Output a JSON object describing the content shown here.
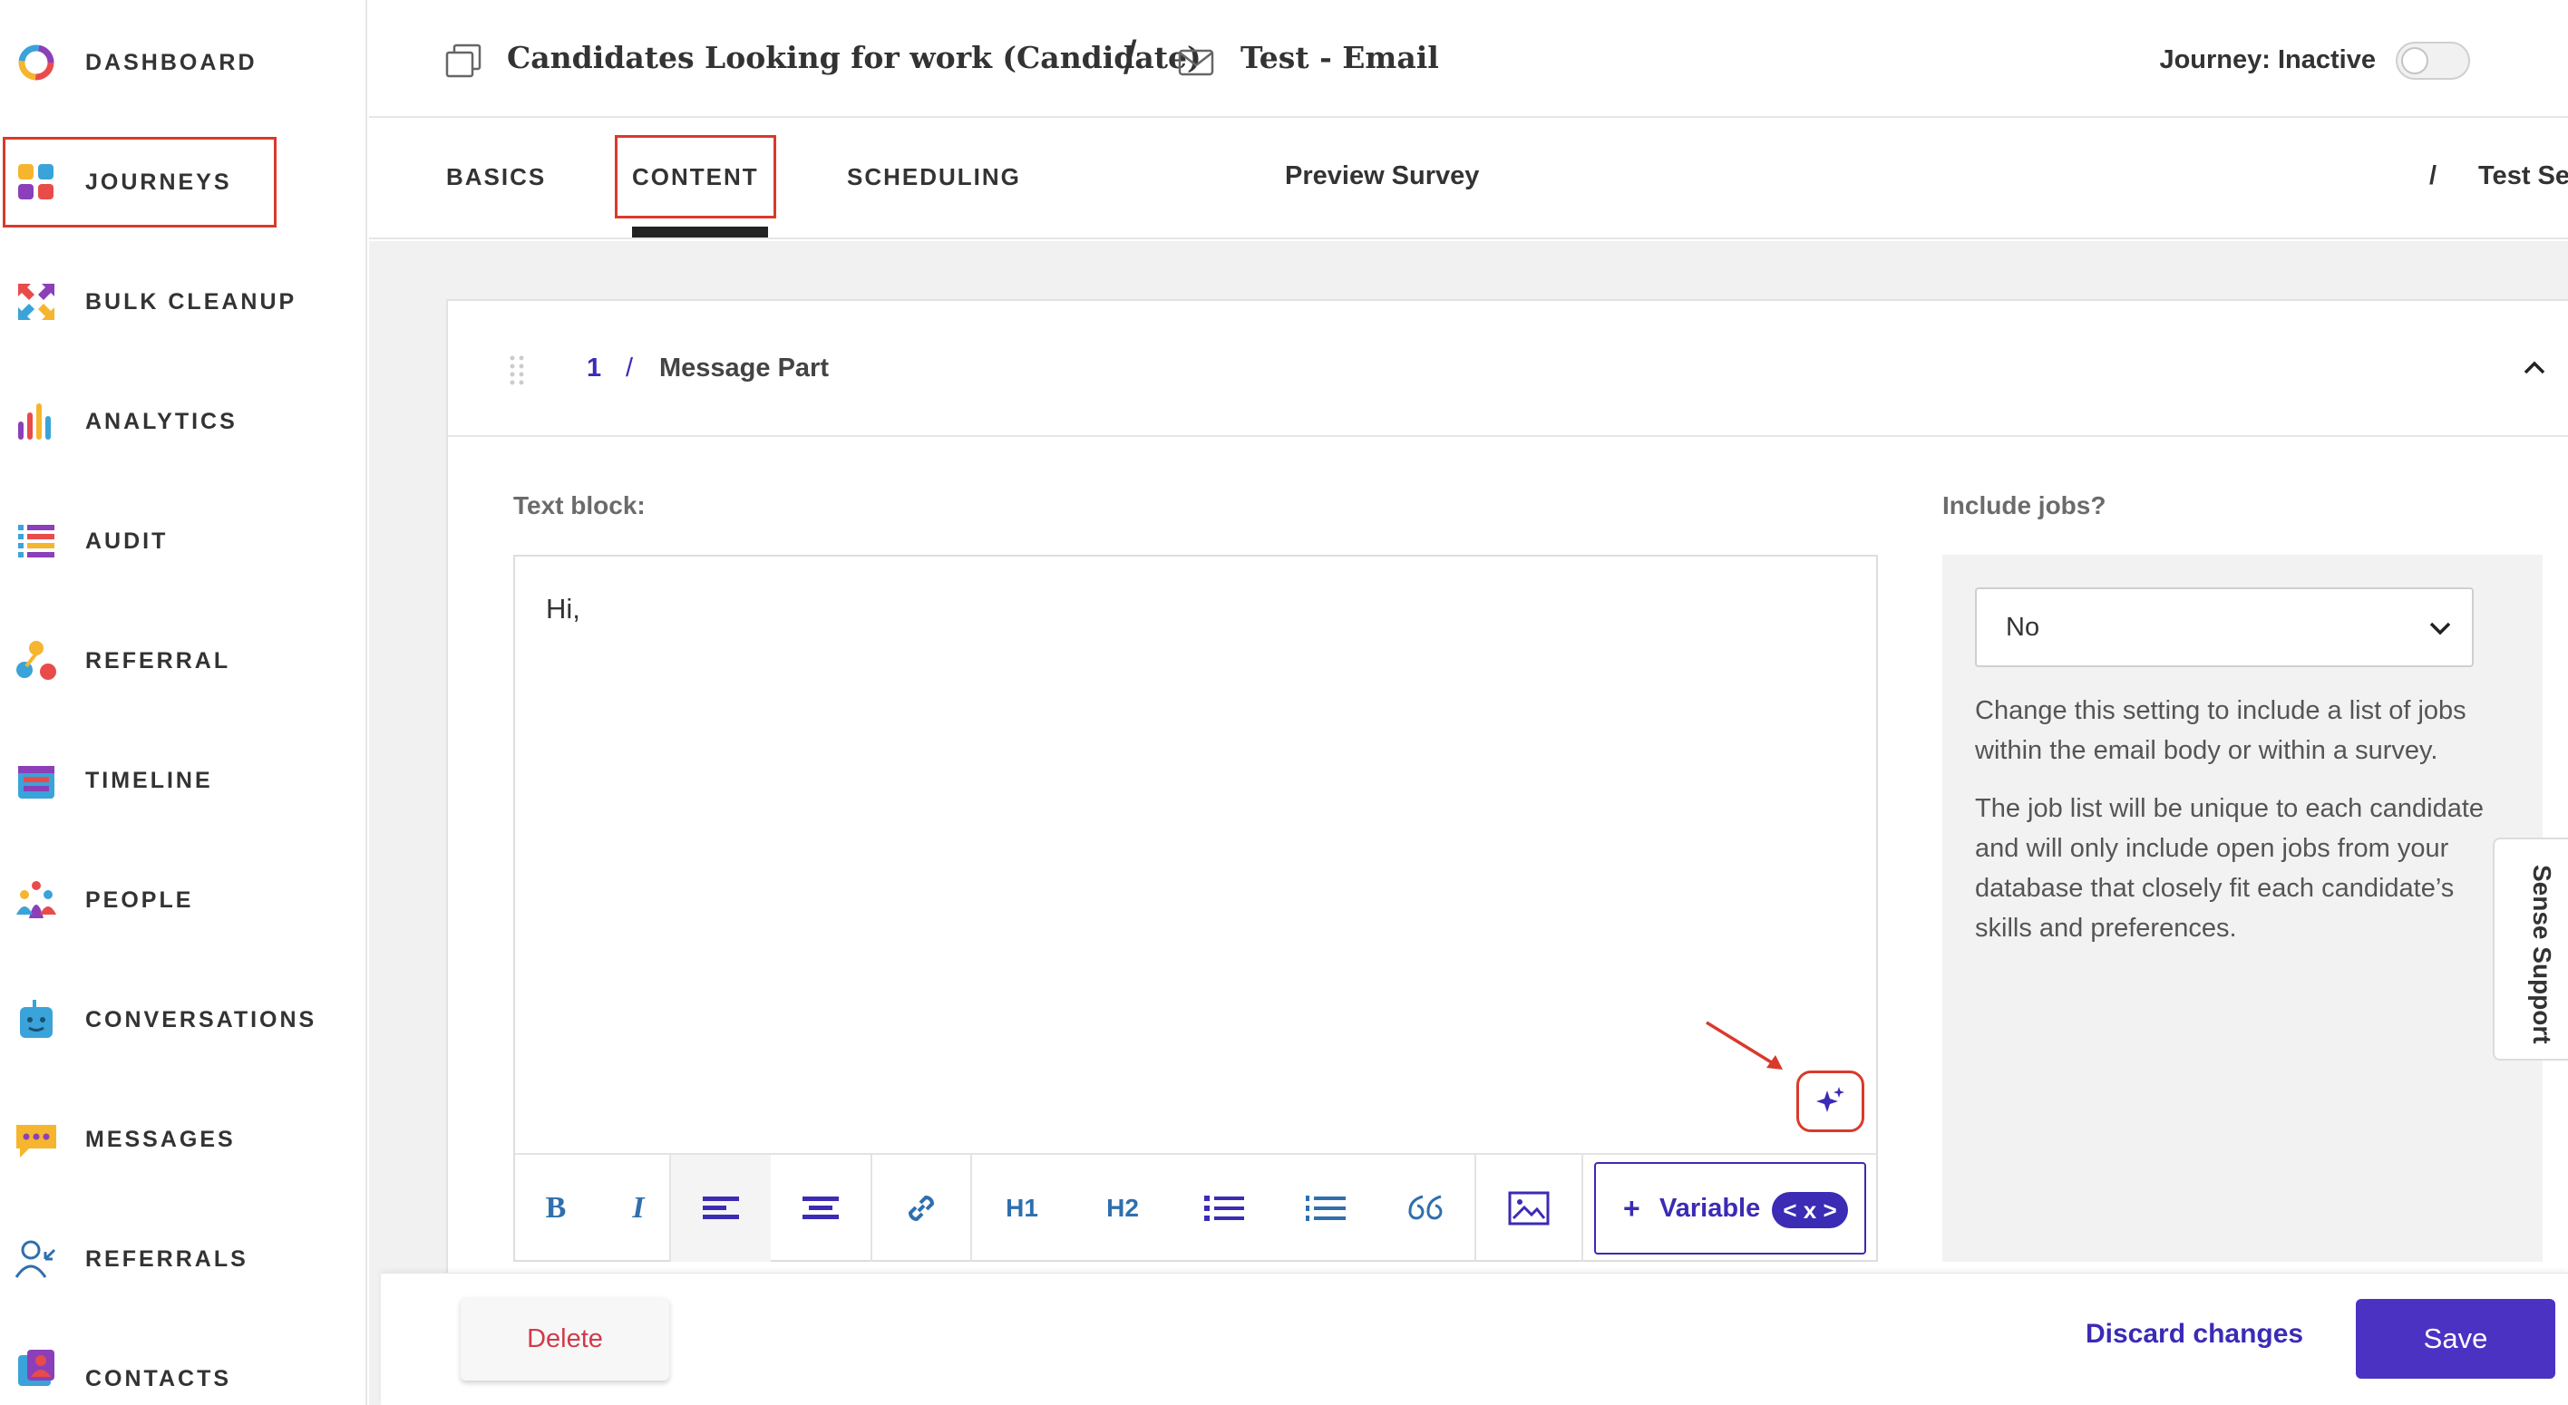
{
  "sidebar": {
    "items": [
      {
        "label": "DASHBOARD",
        "icon": "dashboard-ring-icon"
      },
      {
        "label": "JOURNEYS",
        "icon": "journeys-grid-icon"
      },
      {
        "label": "BULK CLEANUP",
        "icon": "bulk-cleanup-arrows-icon"
      },
      {
        "label": "ANALYTICS",
        "icon": "analytics-bars-icon"
      },
      {
        "label": "AUDIT",
        "icon": "audit-list-icon"
      },
      {
        "label": "REFERRAL",
        "icon": "referral-dots-icon"
      },
      {
        "label": "TIMELINE",
        "icon": "timeline-calendar-icon"
      },
      {
        "label": "PEOPLE",
        "icon": "people-group-icon"
      },
      {
        "label": "CONVERSATIONS",
        "icon": "conversations-robot-icon"
      },
      {
        "label": "MESSAGES",
        "icon": "messages-bubble-icon"
      },
      {
        "label": "REFERRALS",
        "icon": "referrals-person-icon"
      },
      {
        "label": "CONTACTS",
        "icon": "contacts-icon"
      }
    ],
    "active": "JOURNEYS"
  },
  "header": {
    "journey_title": "Candidates Looking for work (Candidate)",
    "separator": "/",
    "step_title": "Test - Email",
    "journey_status": "Journey: Inactive",
    "toggle_on": false
  },
  "tabs": {
    "items": [
      "BASICS",
      "CONTENT",
      "SCHEDULING"
    ],
    "active": "CONTENT",
    "preview_survey": "Preview Survey",
    "separator": "/",
    "test_send": "Test Se"
  },
  "message_part": {
    "number": "1",
    "separator": "/",
    "title": "Message Part"
  },
  "editor": {
    "label": "Text block:",
    "content": "Hi,",
    "toolbar": {
      "bold": "B",
      "italic": "I",
      "h1": "H1",
      "h2": "H2",
      "variable_plus": "+",
      "variable_label": "Variable",
      "variable_chip": "< x >"
    }
  },
  "jobs": {
    "label": "Include jobs?",
    "selected": "No",
    "help_1": "Change this setting to include a list of jobs within the email body or within a survey.",
    "help_2": "The job list will be unique to each candidate and will only include open jobs from your database that closely fit each candidate’s skills and preferences."
  },
  "support": {
    "label": "Sense Support"
  },
  "footer": {
    "delete": "Delete",
    "discard": "Discard changes",
    "save": "Save"
  },
  "colors": {
    "accent": "#4b32c3",
    "link": "#3b2bb5",
    "toolbar_icon": "#2f6fae",
    "highlight": "#d93a2b",
    "danger": "#d13a4a"
  }
}
